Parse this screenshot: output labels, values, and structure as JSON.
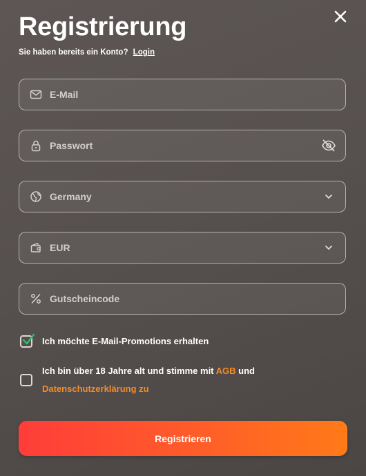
{
  "header": {
    "title": "Registrierung",
    "login_prompt": "Sie haben bereits ein Konto?",
    "login_link": "Login"
  },
  "form": {
    "email": {
      "placeholder": "E-Mail",
      "icon": "mail-icon"
    },
    "password": {
      "placeholder": "Passwort",
      "icon": "lock-icon",
      "toggle_icon": "eye-off-icon"
    },
    "country": {
      "value": "Germany",
      "icon": "globe-icon"
    },
    "currency": {
      "value": "EUR",
      "icon": "wallet-icon"
    },
    "promo": {
      "placeholder": "Gutscheincode",
      "icon": "percent-icon"
    }
  },
  "checkboxes": {
    "promotions": {
      "label": "Ich möchte E-Mail-Promotions erhalten",
      "checked": true
    },
    "terms": {
      "label_before": "Ich bin über 18 Jahre alt und stimme mit",
      "agb_link": "AGB",
      "label_and": "und",
      "privacy_link": "Datenschutzerklärung zu",
      "checked": false
    }
  },
  "submit_label": "Registrieren",
  "colors": {
    "accent_start": "#ff3d3a",
    "accent_end": "#ff7a18",
    "link_orange": "#f28c28",
    "check_green": "#2fbf71"
  }
}
